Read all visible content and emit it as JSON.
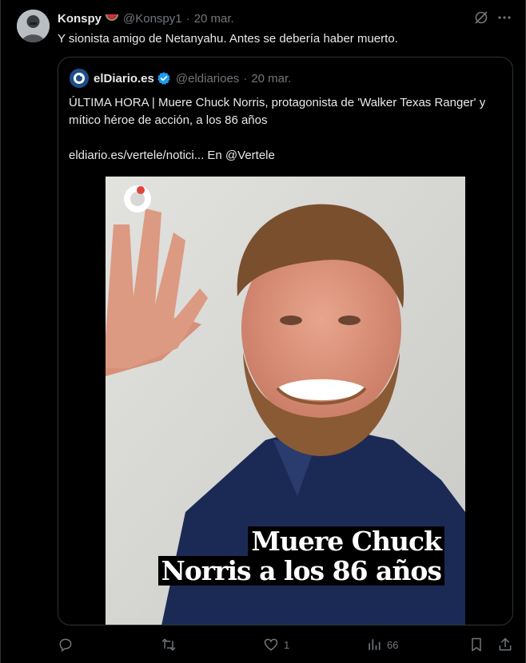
{
  "tweet": {
    "author_name": "Konspy",
    "author_emoji": "watermelon-emoji",
    "author_handle": "@Konspy1",
    "separator": "·",
    "time": "20 mar.",
    "text": "Y sionista amigo de Netanyahu. Antes se debería haber muerto."
  },
  "quoted": {
    "author_name": "elDiario.es",
    "verified": true,
    "author_handle": "@eldiarioes",
    "separator": "·",
    "time": "20 mar.",
    "text": "ÚLTIMA HORA | Muere Chuck Norris, protagonista de 'Walker Texas Ranger' y mítico héroe de acción, a los 86 años",
    "link_text": "eldiario.es/vertele/notici... En @Vertele",
    "image": {
      "headline_line1": "Muere Chuck",
      "headline_line2": "Norris a los 86 años",
      "logo": "eldiario-logo-icon"
    }
  },
  "actions": {
    "reply_count": "",
    "retweet_count": "",
    "like_count": "1",
    "views_count": "66"
  },
  "colors": {
    "background": "#000000",
    "text": "#e7e9ea",
    "muted": "#71767b",
    "border": "#2f3336",
    "verified": "#1d9bf0"
  }
}
